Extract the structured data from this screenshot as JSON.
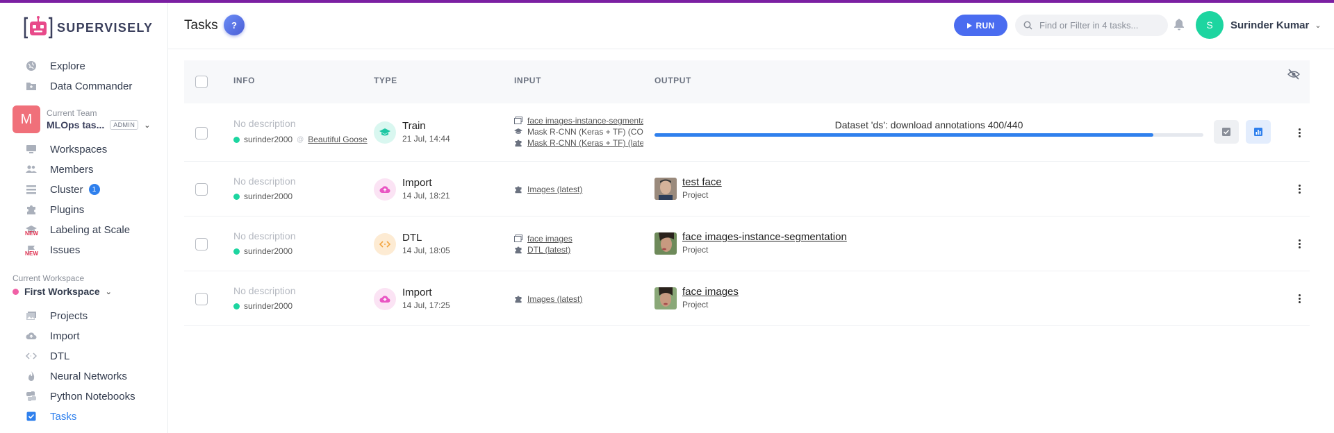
{
  "app": {
    "brand": "SUPERVISELY",
    "accent_color": "#7b1fa2"
  },
  "sidebar": {
    "top_items": [
      {
        "label": "Explore",
        "icon": "globe-icon"
      },
      {
        "label": "Data Commander",
        "icon": "folder-icon"
      }
    ],
    "team": {
      "caption": "Current Team",
      "avatar_letter": "M",
      "name": "MLOps tas...",
      "role": "ADMIN"
    },
    "team_items": [
      {
        "label": "Workspaces",
        "icon": "monitor-icon"
      },
      {
        "label": "Members",
        "icon": "users-icon"
      },
      {
        "label": "Cluster",
        "icon": "list-icon",
        "count": "1"
      },
      {
        "label": "Plugins",
        "icon": "puzzle-icon"
      },
      {
        "label": "Labeling at Scale",
        "icon": "graduation-cap-icon",
        "badge": "NEW"
      },
      {
        "label": "Issues",
        "icon": "flag-icon",
        "badge": "NEW"
      }
    ],
    "workspace": {
      "caption": "Current Workspace",
      "name": "First Workspace"
    },
    "workspace_items": [
      {
        "label": "Projects",
        "icon": "images-icon"
      },
      {
        "label": "Import",
        "icon": "cloud-upload-icon"
      },
      {
        "label": "DTL",
        "icon": "code-icon"
      },
      {
        "label": "Neural Networks",
        "icon": "fire-icon"
      },
      {
        "label": "Python Notebooks",
        "icon": "python-icon"
      },
      {
        "label": "Tasks",
        "icon": "checkbox-icon",
        "active": true
      }
    ]
  },
  "header": {
    "title": "Tasks",
    "help_label": "?",
    "run_label": "RUN",
    "search_placeholder": "Find or Filter in 4 tasks...",
    "user": {
      "avatar_letter": "S",
      "name": "Surinder Kumar"
    }
  },
  "table": {
    "columns": {
      "info": "INFO",
      "type": "TYPE",
      "input": "INPUT",
      "output": "OUTPUT"
    },
    "rows": [
      {
        "description": "No description",
        "owner": "surinder2000",
        "agent": "Beautiful Goose",
        "type": "Train",
        "date": "21 Jul, 14:44",
        "inputs": [
          {
            "icon": "images-icon",
            "text": "face images-instance-segmentation",
            "link": true
          },
          {
            "icon": "graduation-cap-icon",
            "text": "Mask R-CNN (Keras + TF) (COCO)",
            "link": false
          },
          {
            "icon": "puzzle-icon",
            "text": "Mask R-CNN (Keras + TF) (latest)",
            "link": true
          }
        ],
        "progress": {
          "label": "Dataset 'ds': download annotations 400/440",
          "value": 0.909
        }
      },
      {
        "description": "No description",
        "owner": "surinder2000",
        "type": "Import",
        "date": "14 Jul, 18:21",
        "inputs": [
          {
            "icon": "puzzle-icon",
            "text": "Images (latest)",
            "link": true
          }
        ],
        "output": {
          "name": "test face",
          "sub": "Project"
        }
      },
      {
        "description": "No description",
        "owner": "surinder2000",
        "type": "DTL",
        "date": "14 Jul, 18:05",
        "inputs": [
          {
            "icon": "images-icon",
            "text": "face images",
            "link": true
          },
          {
            "icon": "puzzle-icon",
            "text": "DTL (latest)",
            "link": true
          }
        ],
        "output": {
          "name": "face images-instance-segmentation",
          "sub": "Project"
        }
      },
      {
        "description": "No description",
        "owner": "surinder2000",
        "type": "Import",
        "date": "14 Jul, 17:25",
        "inputs": [
          {
            "icon": "puzzle-icon",
            "text": "Images (latest)",
            "link": true
          }
        ],
        "output": {
          "name": "face images",
          "sub": "Project"
        }
      }
    ]
  }
}
